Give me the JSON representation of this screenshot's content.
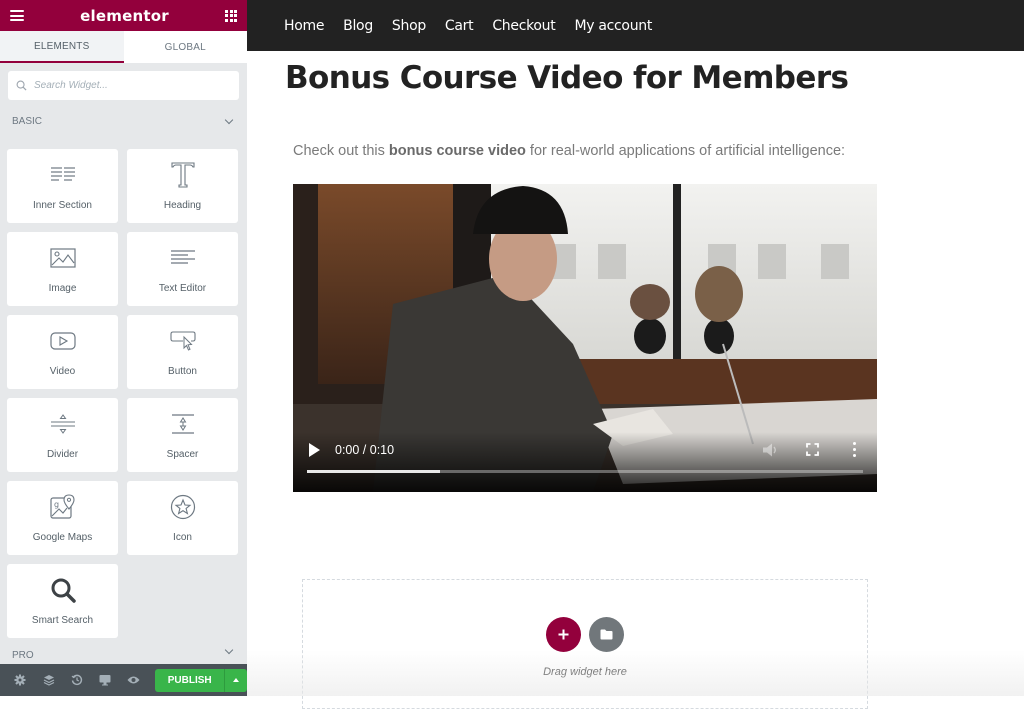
{
  "panel": {
    "brand": "elementor",
    "brand_color": "#93003c",
    "menu_icon": "hamburger-icon",
    "apps_icon": "grid-icon",
    "tabs": [
      {
        "label": "ELEMENTS",
        "active": true
      },
      {
        "label": "GLOBAL",
        "active": false
      }
    ],
    "search": {
      "placeholder": "Search Widget...",
      "value": "",
      "icon": "search-icon"
    },
    "categories": [
      {
        "label": "BASIC",
        "expanded": true
      },
      {
        "label": "PRO",
        "expanded": false
      }
    ],
    "widgets": [
      {
        "label": "Inner Section",
        "icon": "columns-icon"
      },
      {
        "label": "Heading",
        "icon": "heading-icon"
      },
      {
        "label": "Image",
        "icon": "image-icon"
      },
      {
        "label": "Text Editor",
        "icon": "text-editor-icon"
      },
      {
        "label": "Video",
        "icon": "video-icon"
      },
      {
        "label": "Button",
        "icon": "button-icon"
      },
      {
        "label": "Divider",
        "icon": "divider-icon"
      },
      {
        "label": "Spacer",
        "icon": "spacer-icon"
      },
      {
        "label": "Google Maps",
        "icon": "map-icon"
      },
      {
        "label": "Icon",
        "icon": "star-icon"
      },
      {
        "label": "Smart Search",
        "icon": "magnifier-icon"
      }
    ],
    "footer": {
      "icons": [
        "settings-icon",
        "navigator-icon",
        "history-icon",
        "responsive-icon",
        "preview-icon"
      ],
      "publish_label": "PUBLISH",
      "publish_color": "#39b54a"
    }
  },
  "site": {
    "nav": [
      "Home",
      "Blog",
      "Shop",
      "Cart",
      "Checkout",
      "My account"
    ],
    "title": "Bonus Course Video for Members",
    "intro": {
      "before": "Check out this ",
      "bold": "bonus course video",
      "after": " for real-world applications of artificial intelligence:"
    },
    "video": {
      "time": "0:00 / 0:10",
      "buffered_fraction": 0.24
    },
    "drop_zone": {
      "label": "Drag widget here",
      "add_icon": "plus-icon",
      "template_icon": "folder-icon"
    }
  }
}
